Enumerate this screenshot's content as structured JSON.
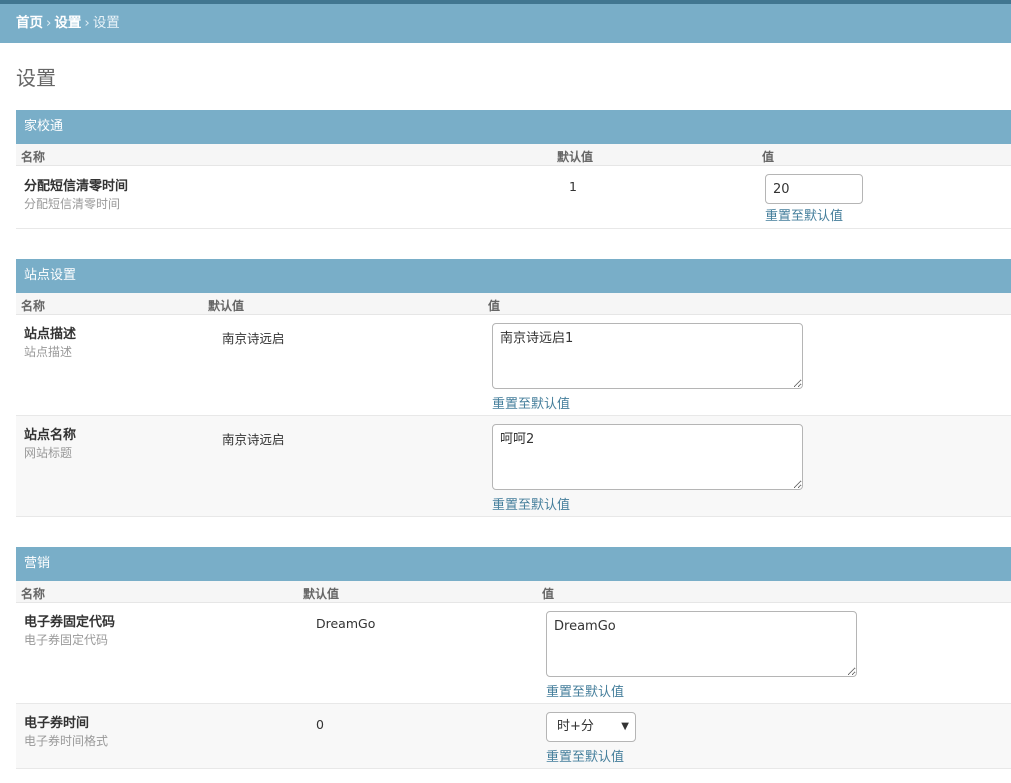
{
  "breadcrumbs": {
    "home": "首页",
    "settings": "设置",
    "current": "设置",
    "separator": "›"
  },
  "page_title": "设置",
  "sections": {
    "jiaxiaotong": {
      "title": "家校通",
      "headers": {
        "name": "名称",
        "default": "默认值",
        "value": "值"
      },
      "rows": [
        {
          "name": "分配短信清零时间",
          "desc": "分配短信清零时间",
          "default": "1",
          "value": "20",
          "reset": "重置至默认值"
        }
      ]
    },
    "site": {
      "title": "站点设置",
      "headers": {
        "name": "名称",
        "default": "默认值",
        "value": "值"
      },
      "rows": [
        {
          "name": "站点描述",
          "desc": "站点描述",
          "default": "南京诗远启",
          "value": "南京诗远启1",
          "reset": "重置至默认值"
        },
        {
          "name": "站点名称",
          "desc": "网站标题",
          "default": "南京诗远启",
          "value": "呵呵2",
          "reset": "重置至默认值"
        }
      ]
    },
    "marketing": {
      "title": "营销",
      "headers": {
        "name": "名称",
        "default": "默认值",
        "value": "值"
      },
      "rows": [
        {
          "name": "电子券固定代码",
          "desc": "电子券固定代码",
          "default": "DreamGo",
          "value": "DreamGo",
          "reset": "重置至默认值"
        },
        {
          "name": "电子券时间",
          "desc": "电子券时间格式",
          "default": "0",
          "value": "时+分",
          "reset": "重置至默认值"
        }
      ]
    }
  },
  "icons": {
    "select_arrow": "▼"
  },
  "colors": {
    "header_bg": "#79aec8",
    "top_strip": "#417690",
    "link": "#447e9b"
  }
}
